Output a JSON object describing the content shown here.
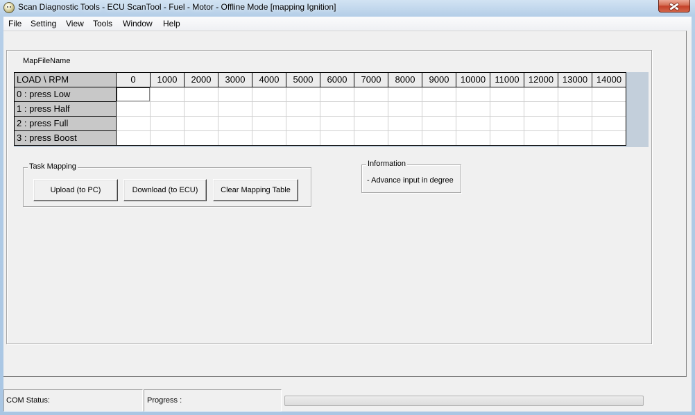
{
  "window": {
    "title": "Scan Diagnostic Tools - ECU ScanTool - Fuel - Motor - Offline Mode [mapping Ignition]",
    "app_icon": "app-icon",
    "close_icon": "close-icon"
  },
  "menu": {
    "items": [
      "File",
      "Setting",
      "View",
      "Tools",
      "Window",
      "Help"
    ]
  },
  "map": {
    "file_name_label": "MapFileName",
    "corner_label": "LOAD \\ RPM",
    "rpm_columns": [
      "0",
      "1000",
      "2000",
      "3000",
      "4000",
      "5000",
      "6000",
      "7000",
      "8000",
      "9000",
      "10000",
      "11000",
      "12000",
      "13000",
      "14000"
    ],
    "load_rows": [
      {
        "label": "0 : press Low",
        "values": [
          "",
          "",
          "",
          "",
          "",
          "",
          "",
          "",
          "",
          "",
          "",
          "",
          "",
          "",
          ""
        ]
      },
      {
        "label": "1 : press Half",
        "values": [
          "",
          "",
          "",
          "",
          "",
          "",
          "",
          "",
          "",
          "",
          "",
          "",
          "",
          "",
          ""
        ]
      },
      {
        "label": "2 : press Full",
        "values": [
          "",
          "",
          "",
          "",
          "",
          "",
          "",
          "",
          "",
          "",
          "",
          "",
          "",
          "",
          ""
        ]
      },
      {
        "label": "3 : press Boost",
        "values": [
          "",
          "",
          "",
          "",
          "",
          "",
          "",
          "",
          "",
          "",
          "",
          "",
          "",
          "",
          ""
        ]
      }
    ],
    "focused_cell": {
      "row": 0,
      "column": 0
    }
  },
  "task_mapping": {
    "title": "Task Mapping",
    "upload_label": "Upload (to PC)",
    "download_label": "Download (to ECU)",
    "clear_label": "Clear Mapping Table"
  },
  "information": {
    "title": "Information",
    "text": "- Advance input in degree"
  },
  "status_bar": {
    "com_status_label": "COM Status:",
    "progress_label": "Progress :",
    "progress_fraction": 0
  },
  "colors": {
    "frame": "#a9c6e3",
    "grid_background": "#c3cfdb",
    "header_fill": "#c8c8c8",
    "close_button": "#c4412a"
  }
}
